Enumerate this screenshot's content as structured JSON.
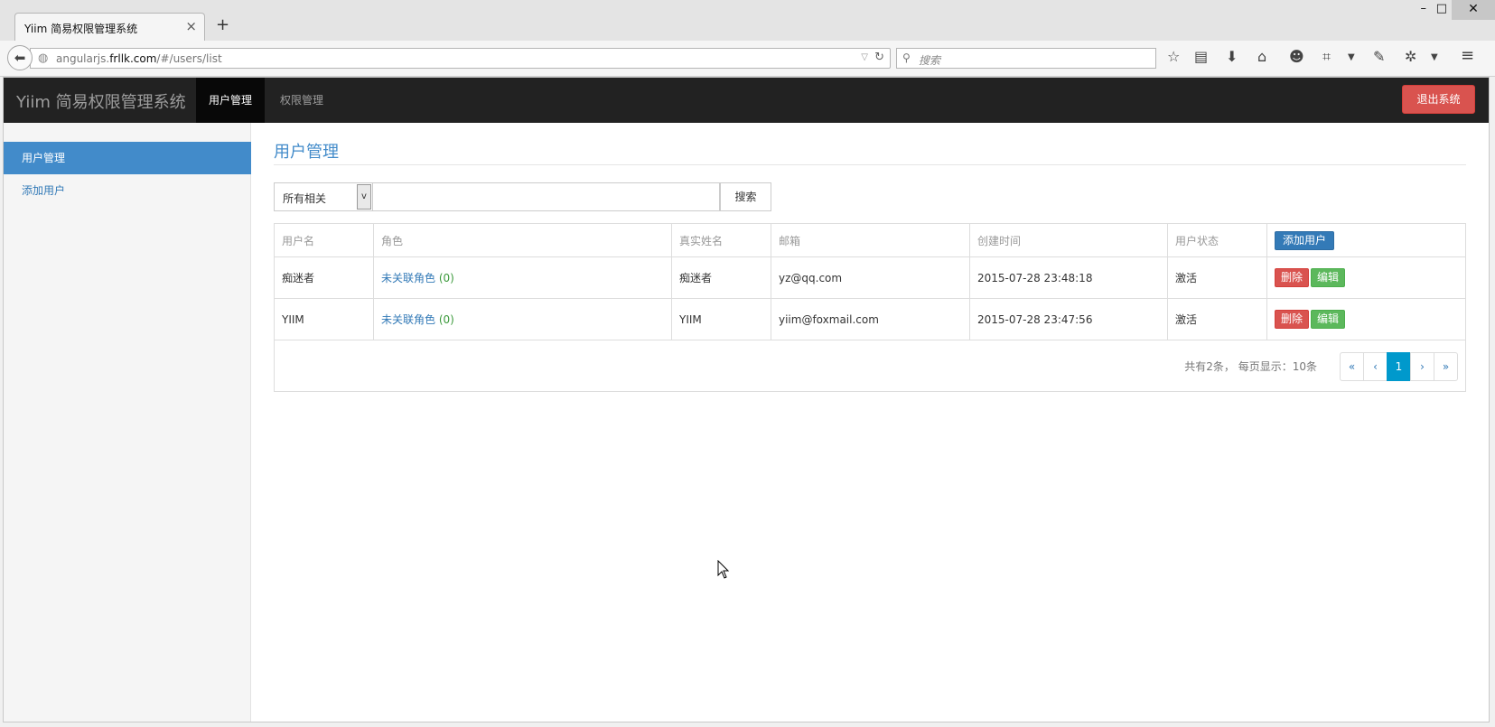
{
  "browser": {
    "tab_title": "Yiim 简易权限管理系统",
    "tab_close": "×",
    "new_tab": "+",
    "url_prefix": "angularjs.",
    "url_host": "frllk.com",
    "url_path": "/#/users/list",
    "search_placeholder": "搜索",
    "window_controls": [
      "–",
      "□",
      "✕"
    ]
  },
  "app": {
    "brand": "Yiim 简易权限管理系统",
    "nav": [
      {
        "label": "用户管理",
        "active": true
      },
      {
        "label": "权限管理",
        "active": false
      }
    ],
    "logout_label": "退出系统"
  },
  "sidebar": {
    "items": [
      {
        "label": "用户管理",
        "active": true
      },
      {
        "label": "添加用户",
        "active": false
      }
    ]
  },
  "main": {
    "title": "用户管理",
    "filter": {
      "selected": "所有相关",
      "input_value": "",
      "search_label": "搜索"
    },
    "table": {
      "headers": [
        "用户名",
        "角色",
        "真实姓名",
        "邮箱",
        "创建时间",
        "用户状态"
      ],
      "add_label": "添加用户",
      "rows": [
        {
          "username": "痴迷者",
          "role_link": "未关联角色",
          "role_count": "(0)",
          "realname": "痴迷者",
          "email": "yz@qq.com",
          "created": "2015-07-28 23:48:18",
          "status": "激活",
          "delete_label": "删除",
          "edit_label": "编辑"
        },
        {
          "username": "YIIM",
          "role_link": "未关联角色",
          "role_count": "(0)",
          "realname": "YIIM",
          "email": "yiim@foxmail.com",
          "created": "2015-07-28 23:47:56",
          "status": "激活",
          "delete_label": "删除",
          "edit_label": "编辑"
        }
      ]
    },
    "pagination": {
      "summary": "共有2条， 每页显示：10条",
      "first": "«",
      "prev": "‹",
      "current": "1",
      "next": "›",
      "last": "»"
    }
  },
  "colors": {
    "navbar_bg": "#222222",
    "sidebar_active": "#428bca",
    "danger": "#d9534f",
    "success": "#5cb85c",
    "primary": "#337ab7",
    "pager_active": "#0099cc"
  }
}
